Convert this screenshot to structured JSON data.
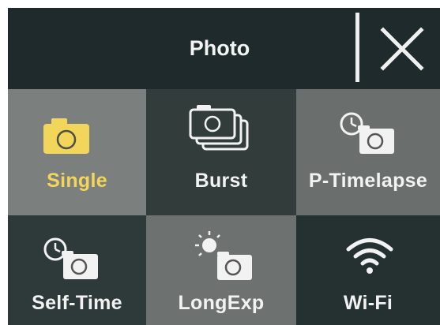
{
  "header": {
    "title": "Photo"
  },
  "modes": [
    {
      "label": "Single",
      "icon": "camera-icon",
      "selected": true
    },
    {
      "label": "Burst",
      "icon": "burst-camera-icon",
      "selected": false
    },
    {
      "label": "P-Timelapse",
      "icon": "timelapse-camera-icon",
      "selected": false
    },
    {
      "label": "Self-Time",
      "icon": "self-timer-camera-icon",
      "selected": false
    },
    {
      "label": "LongExp",
      "icon": "long-exposure-camera-icon",
      "selected": false
    },
    {
      "label": "Wi-Fi",
      "icon": "wifi-icon",
      "selected": false
    }
  ],
  "colors": {
    "header_bg": "#1f2a2c",
    "selected_accent": "#f2d65c",
    "text": "#f2f2f2"
  }
}
